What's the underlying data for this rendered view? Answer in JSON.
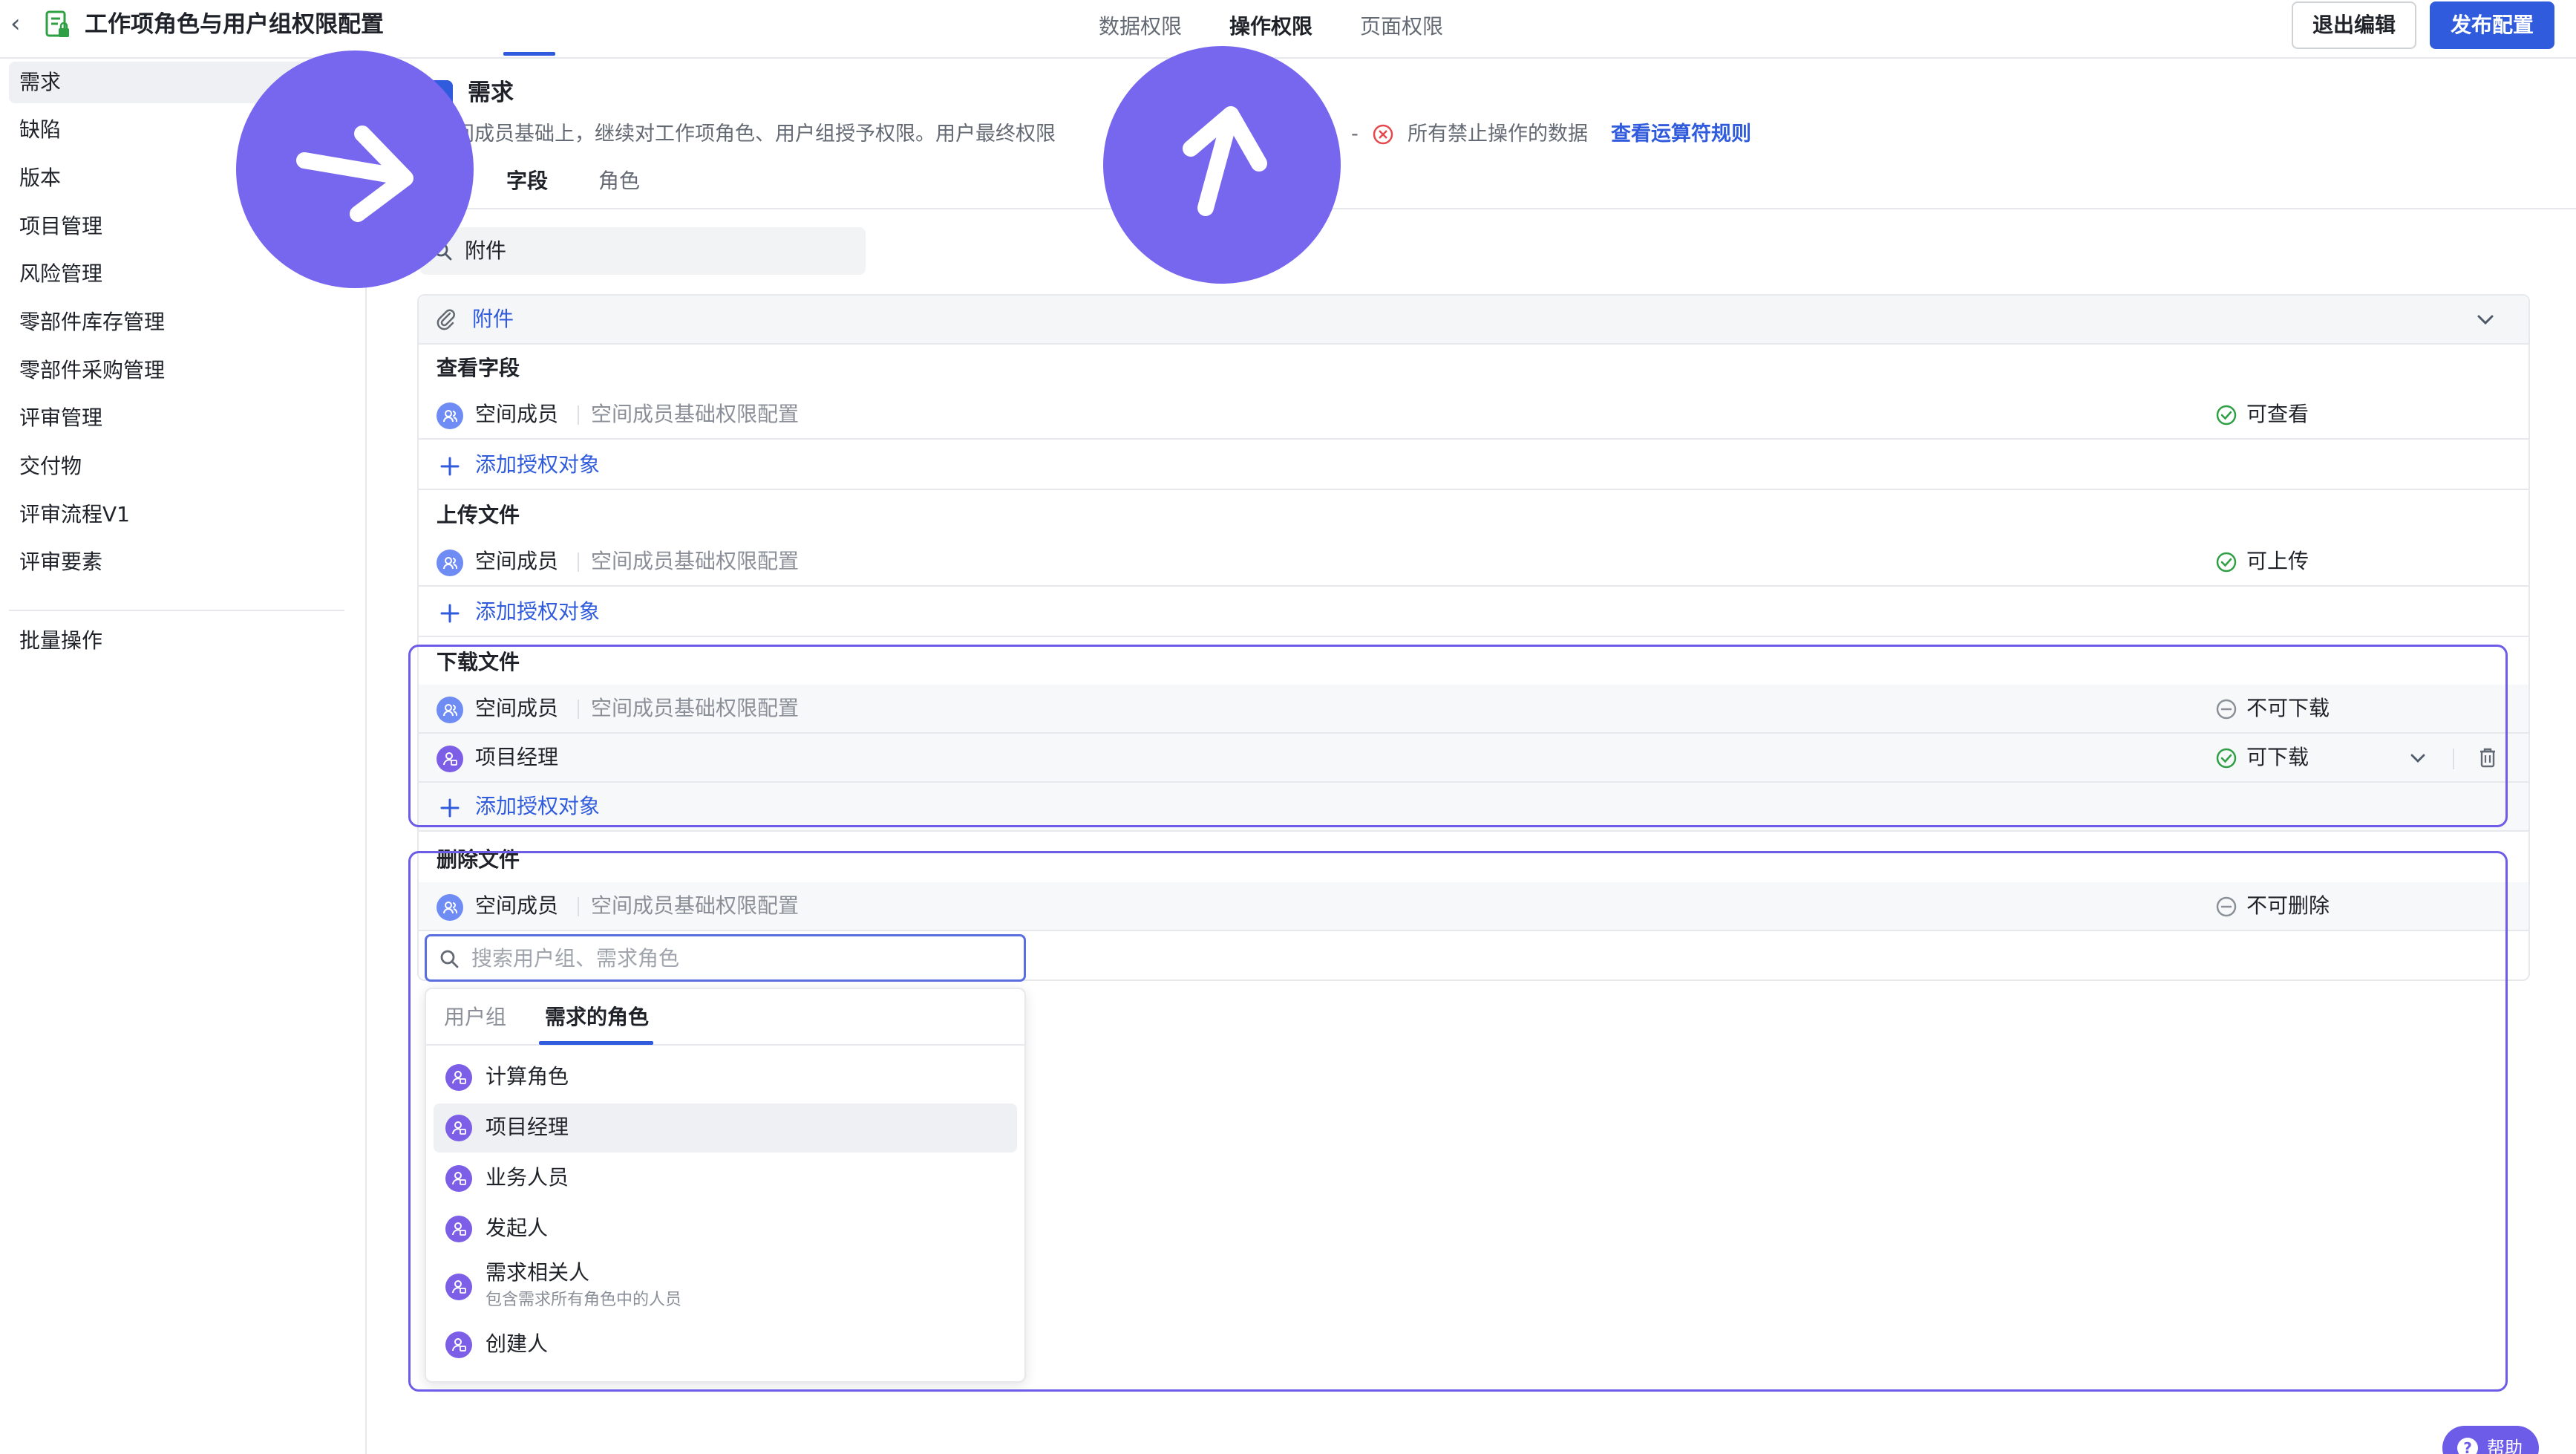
{
  "header": {
    "back_glyph": "‹",
    "title": "工作项角色与用户组权限配置",
    "tabs": [
      "数据权限",
      "操作权限",
      "页面权限"
    ],
    "active_tab": "操作权限",
    "exit_label": "退出编辑",
    "publish_label": "发布配置"
  },
  "sidebar": {
    "items": [
      "需求",
      "缺陷",
      "版本",
      "项目管理",
      "风险管理",
      "零部件库存管理",
      "零部件采购管理",
      "评审管理",
      "交付物",
      "评审流程V1",
      "评审要素"
    ],
    "active_item": "需求",
    "batch_label": "批量操作"
  },
  "main": {
    "title": "需求",
    "desc_left": "间成员基础上，继续对工作项角色、用户组授予权限。用户最终权限",
    "desc_dash": "-",
    "desc_right": "所有禁止操作的数据",
    "rules_link": "查看运算符规则",
    "tabs": [
      "字段",
      "角色"
    ],
    "active_tab": "字段",
    "search_value": "附件"
  },
  "panel": {
    "title": "附件",
    "sections": {
      "view": {
        "title": "查看字段",
        "member_name": "空间成员",
        "member_desc": "空间成员基础权限配置",
        "perm": "可查看",
        "add_label": "添加授权对象"
      },
      "upload": {
        "title": "上传文件",
        "member_name": "空间成员",
        "member_desc": "空间成员基础权限配置",
        "perm": "可上传",
        "add_label": "添加授权对象"
      },
      "download": {
        "title": "下载文件",
        "member_name": "空间成员",
        "member_desc": "空间成员基础权限配置",
        "member_perm": "不可下载",
        "role_name": "项目经理",
        "role_perm": "可下载",
        "add_label": "添加授权对象"
      },
      "delete": {
        "title": "删除文件",
        "member_name": "空间成员",
        "member_desc": "空间成员基础权限配置",
        "member_perm": "不可删除",
        "search_placeholder": "搜索用户组、需求角色"
      }
    }
  },
  "dropdown": {
    "tabs": [
      "用户组",
      "需求的角色"
    ],
    "active_tab": "需求的角色",
    "items": [
      {
        "name": "计算角色"
      },
      {
        "name": "项目经理"
      },
      {
        "name": "业务人员"
      },
      {
        "name": "发起人"
      },
      {
        "name": "需求相关人",
        "sub": "包含需求所有角色中的人员"
      },
      {
        "name": "创建人"
      }
    ],
    "hovered_item": "项目经理"
  },
  "help_label": "帮助",
  "colors": {
    "accent": "#2f5bdc",
    "highlight": "#6c5ce7",
    "allow": "#2ea043",
    "deny": "#8a8f98",
    "error": "#e5484d"
  }
}
